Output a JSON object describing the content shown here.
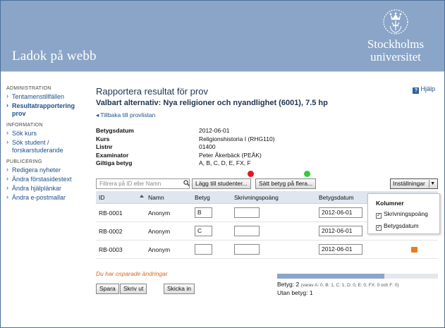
{
  "header": {
    "app_title": "Ladok på webb",
    "logo_line1": "Stockholms",
    "logo_line2": "universitet"
  },
  "sidebar": {
    "sections": [
      {
        "heading": "ADMINISTRATION",
        "items": [
          {
            "label": "Tentamenstillfällen",
            "active": false
          },
          {
            "label": "Resultatrapportering prov",
            "active": true
          }
        ]
      },
      {
        "heading": "INFORMATION",
        "items": [
          {
            "label": "Sök kurs",
            "active": false
          },
          {
            "label": "Sök student / forskarstuderande",
            "active": false
          }
        ]
      },
      {
        "heading": "PUBLICERING",
        "items": [
          {
            "label": "Redigera nyheter",
            "active": false
          },
          {
            "label": "Ändra förstasidestext",
            "active": false
          },
          {
            "label": "Ändra hjälplänkar",
            "active": false
          },
          {
            "label": "Ändra e-postmallar",
            "active": false
          }
        ]
      }
    ]
  },
  "main": {
    "title": "Rapportera resultat för prov",
    "help_label": "Hjälp",
    "subtitle": "Valbart alternativ: Nya religioner och nyandlighet (6001), 7.5 hp",
    "back_link": "Tillbaka till provlistan",
    "info": [
      {
        "k": "Betygsdatum",
        "v": "2012-06-01"
      },
      {
        "k": "Kurs",
        "v": "Religionshistoria I (RHG110)"
      },
      {
        "k": "Listnr",
        "v": "01400"
      },
      {
        "k": "Examinator",
        "v": "Peter Åkerbäck (PEÅK)"
      },
      {
        "k": "Giltiga betyg",
        "v": "A, B, C, D, E, FX, F"
      }
    ]
  },
  "toolbar": {
    "filter_placeholder": "Filtrera på ID eller Namn",
    "add_students": "Lägg till studenter...",
    "set_grade_multi": "Sätt betyg på flera...",
    "settings": "Inställningar"
  },
  "table": {
    "headers": {
      "id": "ID",
      "name": "Namn",
      "grade": "Betyg",
      "credits": "Skrivningspoäng",
      "date": "Betygsdatum"
    },
    "rows": [
      {
        "id": "RB-0001",
        "name": "Anonym",
        "grade": "B",
        "credits": "",
        "date": "2012-06-01"
      },
      {
        "id": "RB-0002",
        "name": "Anonym",
        "grade": "C",
        "credits": "",
        "date": "2012-06-01"
      },
      {
        "id": "RB-0003",
        "name": "Anonym",
        "grade": "",
        "credits": "",
        "date": "2012-06-01"
      }
    ]
  },
  "settings_panel": {
    "title": "Kolumner",
    "options": [
      {
        "label": "Skrivningspoäng",
        "checked": true
      },
      {
        "label": "Betygsdatum",
        "checked": true
      }
    ]
  },
  "footer": {
    "unsaved": "Du har osparade ändringar",
    "save": "Spara",
    "print": "Skriv ut",
    "submit": "Skicka in",
    "grade_count_label": "Betyg: 2",
    "grade_breakdown": "(varav A: 0, B: 1, C: 1, D: 0, E: 0, FX: 0 och F: 0)",
    "without_grade": "Utan betyg: 1",
    "progress_fraction": 0.667
  },
  "colors": {
    "header_bg": "#8aa5c7",
    "link": "#1f4f8a",
    "red_marker": "#e8161a",
    "green_marker": "#36c93a",
    "orange_flag": "#e87d1e"
  }
}
